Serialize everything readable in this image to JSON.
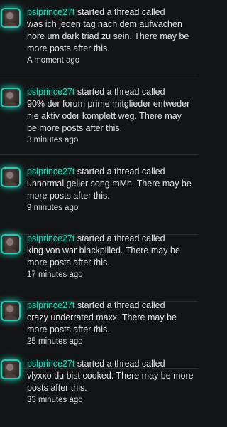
{
  "activity": {
    "items": [
      {
        "username": "pslprince27t",
        "action": "started a thread called",
        "message": "was ich jeden tag nach dem aufwachen höre um dark triad zu sein. There may be more posts after this.",
        "time": "A moment ago"
      },
      {
        "username": "pslprince27t",
        "action": "started a thread called",
        "message": "90% der forum prime mitglieder entweder nie aktiv oder komplett weg. There may be more posts after this.",
        "time": "3 minutes ago"
      },
      {
        "username": "pslprince27t",
        "action": "started a thread called",
        "message": "unnormal geiler song mMn. There may be more posts after this.",
        "time": "9 minutes ago"
      },
      {
        "username": "pslprince27t",
        "action": "started a thread called",
        "message": "king von war blackpilled. There may be more posts after this.",
        "time": "17 minutes ago"
      },
      {
        "username": "pslprince27t",
        "action": "started a thread called",
        "message": "crazy underrated maxx. There may be more posts after this.",
        "time": "25 minutes ago"
      },
      {
        "username": "pslprince27t",
        "action": "started a thread called",
        "message": "vlyxxo du bist cooked. There may be more posts after this.",
        "time": "33 minutes ago"
      }
    ]
  },
  "colors": {
    "background": "#131416",
    "username": "#26d3b3",
    "text": "#e3e3e3",
    "divider": "#2a2c30"
  }
}
